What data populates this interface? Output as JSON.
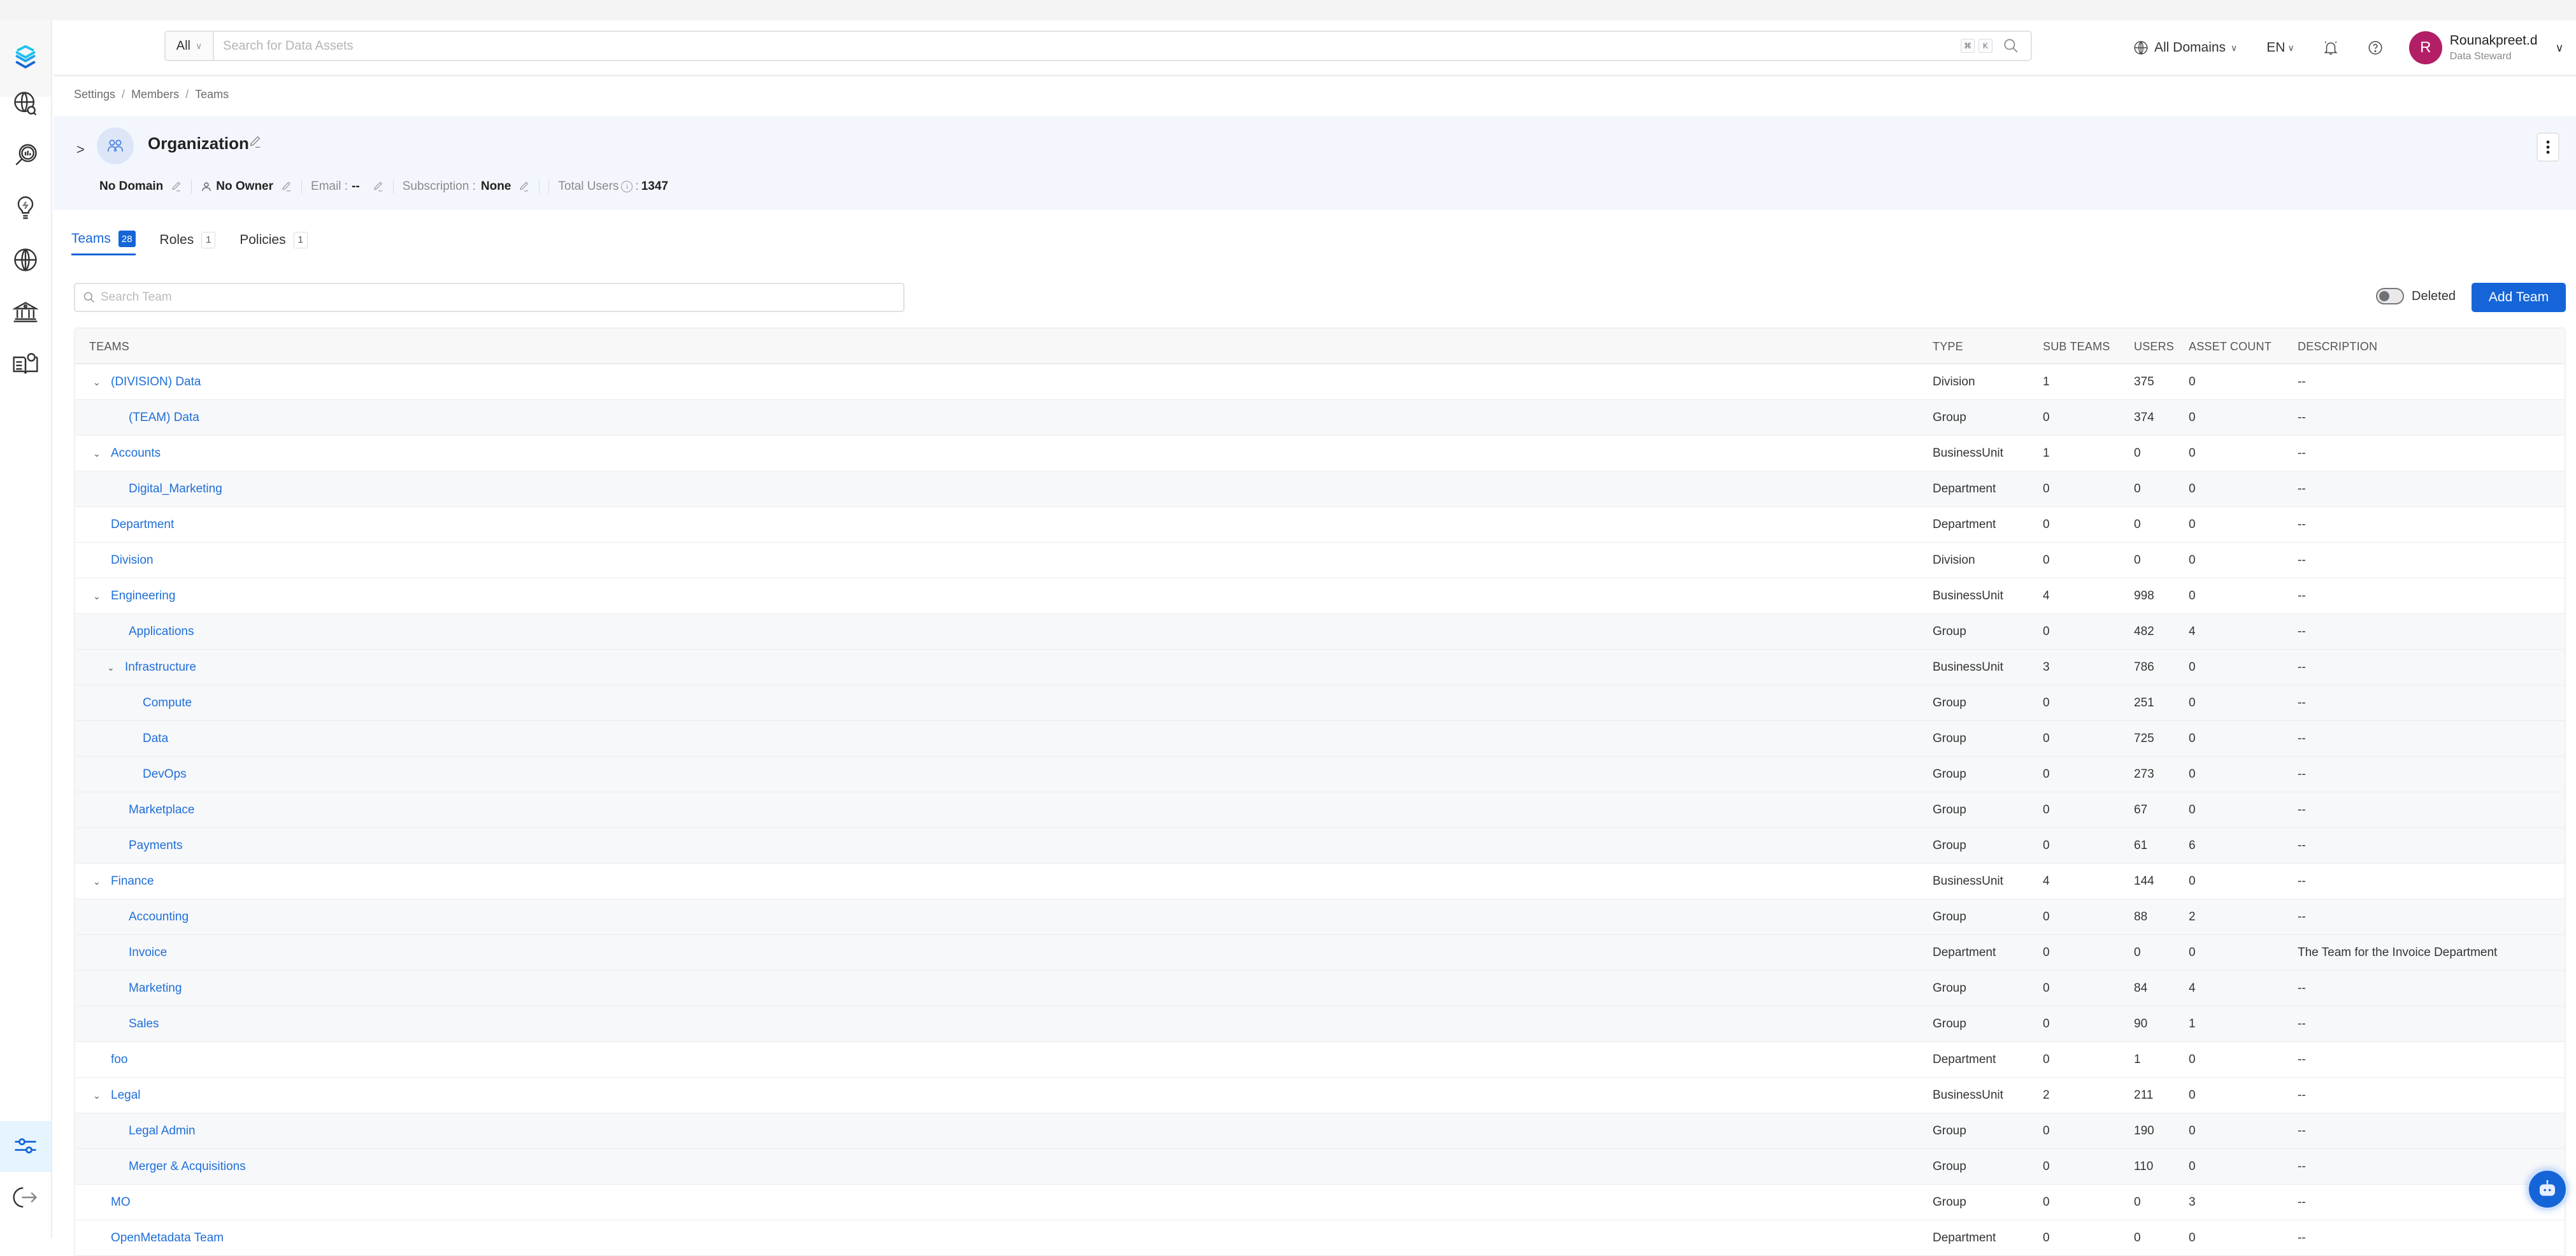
{
  "header": {
    "search_category": "All",
    "search_placeholder": "Search for Data Assets",
    "shortcut_keys": [
      "⌘",
      "K"
    ],
    "domain_selector": "All Domains",
    "language": "EN",
    "user": {
      "initial": "R",
      "name": "Rounakpreet.d",
      "role": "Data Steward",
      "avatar_color": "#b21f66"
    }
  },
  "sidebar": {
    "items": [
      {
        "name": "explore",
        "icon": "globe-search-icon"
      },
      {
        "name": "data-quality",
        "icon": "magnifier-chart-icon"
      },
      {
        "name": "insights",
        "icon": "lightbulb-icon"
      },
      {
        "name": "domains",
        "icon": "globe-icon"
      },
      {
        "name": "governance",
        "icon": "bank-icon"
      },
      {
        "name": "glossary",
        "icon": "book-bulb-icon"
      },
      {
        "name": "settings",
        "icon": "sliders-icon",
        "active": true
      },
      {
        "name": "logout",
        "icon": "logout-icon"
      }
    ]
  },
  "breadcrumb": [
    "Settings",
    "Members",
    "Teams"
  ],
  "organization": {
    "name": "Organization",
    "domain": "No Domain",
    "owner": "No Owner",
    "email_label": "Email :",
    "email_value": "--",
    "subscription_label": "Subscription :",
    "subscription_value": "None",
    "total_users_label": "Total Users",
    "total_users_value": "1347"
  },
  "tabs": [
    {
      "label": "Teams",
      "count": "28",
      "active": true
    },
    {
      "label": "Roles",
      "count": "1"
    },
    {
      "label": "Policies",
      "count": "1"
    }
  ],
  "toolbar": {
    "search_placeholder": "Search Team",
    "deleted_label": "Deleted",
    "deleted_on": false,
    "add_team_label": "Add Team"
  },
  "table": {
    "columns": [
      "TEAMS",
      "TYPE",
      "SUB TEAMS",
      "USERS",
      "ASSET COUNT",
      "DESCRIPTION"
    ],
    "rows": [
      {
        "name": "(DIVISION) Data",
        "level": 0,
        "expanded": true,
        "type": "Division",
        "sub_teams": "1",
        "users": "375",
        "assets": "0",
        "description": "--"
      },
      {
        "name": "(TEAM) Data",
        "level": 1,
        "type": "Group",
        "sub_teams": "0",
        "users": "374",
        "assets": "0",
        "description": "--"
      },
      {
        "name": "Accounts",
        "level": 0,
        "expanded": true,
        "type": "BusinessUnit",
        "sub_teams": "1",
        "users": "0",
        "assets": "0",
        "description": "--"
      },
      {
        "name": "Digital_Marketing",
        "level": 1,
        "type": "Department",
        "sub_teams": "0",
        "users": "0",
        "assets": "0",
        "description": "--"
      },
      {
        "name": "Department",
        "level": 0,
        "type": "Department",
        "sub_teams": "0",
        "users": "0",
        "assets": "0",
        "description": "--"
      },
      {
        "name": "Division",
        "level": 0,
        "type": "Division",
        "sub_teams": "0",
        "users": "0",
        "assets": "0",
        "description": "--"
      },
      {
        "name": "Engineering",
        "level": 0,
        "expanded": true,
        "type": "BusinessUnit",
        "sub_teams": "4",
        "users": "998",
        "assets": "0",
        "description": "--"
      },
      {
        "name": "Applications",
        "level": 1,
        "type": "Group",
        "sub_teams": "0",
        "users": "482",
        "assets": "4",
        "description": "--"
      },
      {
        "name": "Infrastructure",
        "level": 1,
        "expanded": true,
        "type": "BusinessUnit",
        "sub_teams": "3",
        "users": "786",
        "assets": "0",
        "description": "--"
      },
      {
        "name": "Compute",
        "level": 2,
        "type": "Group",
        "sub_teams": "0",
        "users": "251",
        "assets": "0",
        "description": "--"
      },
      {
        "name": "Data",
        "level": 2,
        "type": "Group",
        "sub_teams": "0",
        "users": "725",
        "assets": "0",
        "description": "--"
      },
      {
        "name": "DevOps",
        "level": 2,
        "type": "Group",
        "sub_teams": "0",
        "users": "273",
        "assets": "0",
        "description": "--"
      },
      {
        "name": "Marketplace",
        "level": 1,
        "type": "Group",
        "sub_teams": "0",
        "users": "67",
        "assets": "0",
        "description": "--"
      },
      {
        "name": "Payments",
        "level": 1,
        "type": "Group",
        "sub_teams": "0",
        "users": "61",
        "assets": "6",
        "description": "--"
      },
      {
        "name": "Finance",
        "level": 0,
        "expanded": true,
        "type": "BusinessUnit",
        "sub_teams": "4",
        "users": "144",
        "assets": "0",
        "description": "--"
      },
      {
        "name": "Accounting",
        "level": 1,
        "type": "Group",
        "sub_teams": "0",
        "users": "88",
        "assets": "2",
        "description": "--"
      },
      {
        "name": "Invoice",
        "level": 1,
        "type": "Department",
        "sub_teams": "0",
        "users": "0",
        "assets": "0",
        "description": "The Team for the Invoice Department"
      },
      {
        "name": "Marketing",
        "level": 1,
        "type": "Group",
        "sub_teams": "0",
        "users": "84",
        "assets": "4",
        "description": "--"
      },
      {
        "name": "Sales",
        "level": 1,
        "type": "Group",
        "sub_teams": "0",
        "users": "90",
        "assets": "1",
        "description": "--"
      },
      {
        "name": "foo",
        "level": 0,
        "type": "Department",
        "sub_teams": "0",
        "users": "1",
        "assets": "0",
        "description": "--"
      },
      {
        "name": "Legal",
        "level": 0,
        "expanded": true,
        "type": "BusinessUnit",
        "sub_teams": "2",
        "users": "211",
        "assets": "0",
        "description": "--"
      },
      {
        "name": "Legal Admin",
        "level": 1,
        "type": "Group",
        "sub_teams": "0",
        "users": "190",
        "assets": "0",
        "description": "--"
      },
      {
        "name": "Merger & Acquisitions",
        "level": 1,
        "type": "Group",
        "sub_teams": "0",
        "users": "110",
        "assets": "0",
        "description": "--"
      },
      {
        "name": "MO",
        "level": 0,
        "type": "Group",
        "sub_teams": "0",
        "users": "0",
        "assets": "3",
        "description": "--"
      },
      {
        "name": "OpenMetadata Team",
        "level": 0,
        "type": "Department",
        "sub_teams": "0",
        "users": "0",
        "assets": "0",
        "description": "--"
      }
    ]
  },
  "colors": {
    "accent": "#1565d8",
    "link": "#1e6ed8",
    "banner_bg": "#f3f7fd"
  }
}
